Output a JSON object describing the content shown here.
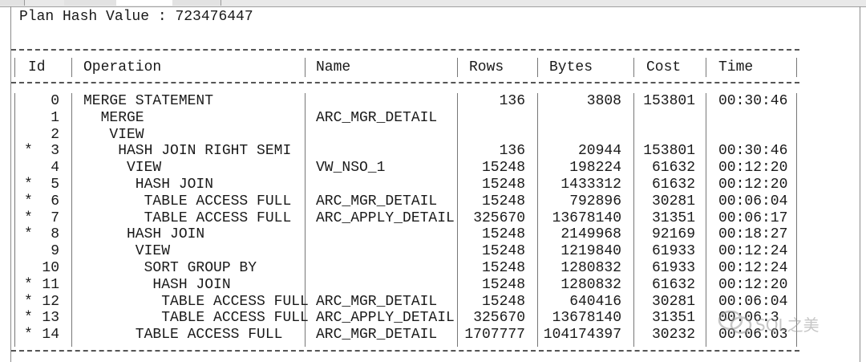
{
  "plan": {
    "hash_label": "Plan Hash Value",
    "hash_sep": " : ",
    "hash_value": "723476447"
  },
  "columns": {
    "id": "Id",
    "operation": "Operation",
    "name": "Name",
    "rows": "Rows",
    "bytes": "Bytes",
    "cost": "Cost",
    "time": "Time"
  },
  "rows": [
    {
      "marker": "",
      "id": "0",
      "operation": "MERGE STATEMENT",
      "name": "",
      "rows": "136",
      "bytes": "3808",
      "cost": "153801",
      "time": "00:30:46"
    },
    {
      "marker": "",
      "id": "1",
      "operation": "  MERGE",
      "name": "ARC_MGR_DETAIL",
      "rows": "",
      "bytes": "",
      "cost": "",
      "time": ""
    },
    {
      "marker": "",
      "id": "2",
      "operation": "   VIEW",
      "name": "",
      "rows": "",
      "bytes": "",
      "cost": "",
      "time": ""
    },
    {
      "marker": "*",
      "id": "3",
      "operation": "    HASH JOIN RIGHT SEMI",
      "name": "",
      "rows": "136",
      "bytes": "20944",
      "cost": "153801",
      "time": "00:30:46"
    },
    {
      "marker": "",
      "id": "4",
      "operation": "     VIEW",
      "name": "VW_NSO_1",
      "rows": "15248",
      "bytes": "198224",
      "cost": "61632",
      "time": "00:12:20"
    },
    {
      "marker": "*",
      "id": "5",
      "operation": "      HASH JOIN",
      "name": "",
      "rows": "15248",
      "bytes": "1433312",
      "cost": "61632",
      "time": "00:12:20"
    },
    {
      "marker": "*",
      "id": "6",
      "operation": "       TABLE ACCESS FULL",
      "name": "ARC_MGR_DETAIL",
      "rows": "15248",
      "bytes": "792896",
      "cost": "30281",
      "time": "00:06:04"
    },
    {
      "marker": "*",
      "id": "7",
      "operation": "       TABLE ACCESS FULL",
      "name": "ARC_APPLY_DETAIL",
      "rows": "325670",
      "bytes": "13678140",
      "cost": "31351",
      "time": "00:06:17"
    },
    {
      "marker": "*",
      "id": "8",
      "operation": "     HASH JOIN",
      "name": "",
      "rows": "15248",
      "bytes": "2149968",
      "cost": "92169",
      "time": "00:18:27"
    },
    {
      "marker": "",
      "id": "9",
      "operation": "      VIEW",
      "name": "",
      "rows": "15248",
      "bytes": "1219840",
      "cost": "61933",
      "time": "00:12:24"
    },
    {
      "marker": "",
      "id": "10",
      "operation": "       SORT GROUP BY",
      "name": "",
      "rows": "15248",
      "bytes": "1280832",
      "cost": "61933",
      "time": "00:12:24"
    },
    {
      "marker": "*",
      "id": "11",
      "operation": "        HASH JOIN",
      "name": "",
      "rows": "15248",
      "bytes": "1280832",
      "cost": "61632",
      "time": "00:12:20"
    },
    {
      "marker": "*",
      "id": "12",
      "operation": "         TABLE ACCESS FULL",
      "name": "ARC_MGR_DETAIL",
      "rows": "15248",
      "bytes": "640416",
      "cost": "30281",
      "time": "00:06:04"
    },
    {
      "marker": "*",
      "id": "13",
      "operation": "         TABLE ACCESS FULL",
      "name": "ARC_APPLY_DETAIL",
      "rows": "325670",
      "bytes": "13678140",
      "cost": "31351",
      "time": "00:06:3"
    },
    {
      "marker": "*",
      "id": "14",
      "operation": "      TABLE ACCESS FULL",
      "name": "ARC_MGR_DETAIL",
      "rows": "1707777",
      "bytes": "104174397",
      "cost": "30232",
      "time": "00:06:03"
    }
  ],
  "watermark": {
    "text": "SQL之美",
    "icon": "wechat-icon",
    "color": "#9a9a9a"
  },
  "colors": {
    "text": "#1a1a1a",
    "rule": "#555555",
    "background": "#ffffff"
  }
}
